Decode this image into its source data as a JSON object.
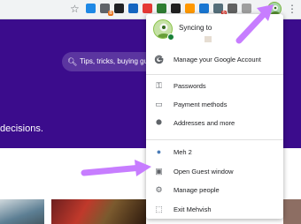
{
  "browser": {
    "bookmark_icon": "star-outline-icon",
    "extensions": [
      {
        "icon": "extension-toggle-icon",
        "color": "#1e88e5",
        "badge": "",
        "badge_color": ""
      },
      {
        "icon": "extension-badge-icon",
        "color": "#5f6368",
        "badge": "8",
        "badge_color": "#e8711a"
      },
      {
        "icon": "eyedropper-icon",
        "color": "#202124",
        "badge": "",
        "badge_color": ""
      },
      {
        "icon": "extension-blue-icon",
        "color": "#1565c0",
        "badge": "",
        "badge_color": ""
      },
      {
        "icon": "extension-fire-icon",
        "color": "#e53935",
        "badge": "",
        "badge_color": ""
      },
      {
        "icon": "extension-link-icon",
        "color": "#2e7d32",
        "badge": "",
        "badge_color": ""
      },
      {
        "icon": "extension-record-icon",
        "color": "#212121",
        "badge": "",
        "badge_color": ""
      },
      {
        "icon": "extension-grid-icon",
        "color": "#ff9800",
        "badge": "",
        "badge_color": ""
      },
      {
        "icon": "extension-shield-icon",
        "color": "#1976d2",
        "badge": "",
        "badge_color": ""
      },
      {
        "icon": "extension-save-icon",
        "color": "#546e7a",
        "badge": "6",
        "badge_color": "#d93025"
      },
      {
        "icon": "extension-box-icon",
        "color": "#616161",
        "badge": "",
        "badge_color": ""
      },
      {
        "icon": "cloud-icon",
        "color": "#9e9e9e",
        "badge": "",
        "badge_color": ""
      }
    ],
    "profile_icon": "profile-avatar-icon",
    "menu_icon": "kebab-menu-icon"
  },
  "site": {
    "search_placeholder": "Tips, tricks, buying guid",
    "hero_text": "decisions."
  },
  "profile_menu": {
    "sync_status": "Syncing to",
    "manage_account": "Manage your Google Account",
    "autofill": [
      {
        "icon": "key-icon",
        "label": "Passwords"
      },
      {
        "icon": "credit-card-icon",
        "label": "Payment methods"
      },
      {
        "icon": "location-pin-icon",
        "label": "Addresses and more"
      }
    ],
    "people": [
      {
        "icon": "profile-avatar-icon",
        "label": "Meh 2"
      },
      {
        "icon": "guest-icon",
        "label": "Open Guest window"
      },
      {
        "icon": "gear-icon",
        "label": "Manage people"
      },
      {
        "icon": "exit-icon",
        "label": "Exit Mehvish"
      }
    ]
  },
  "colors": {
    "hero": "#3b0c8c",
    "arrow": "#c77dff",
    "sync_green": "#188038"
  }
}
